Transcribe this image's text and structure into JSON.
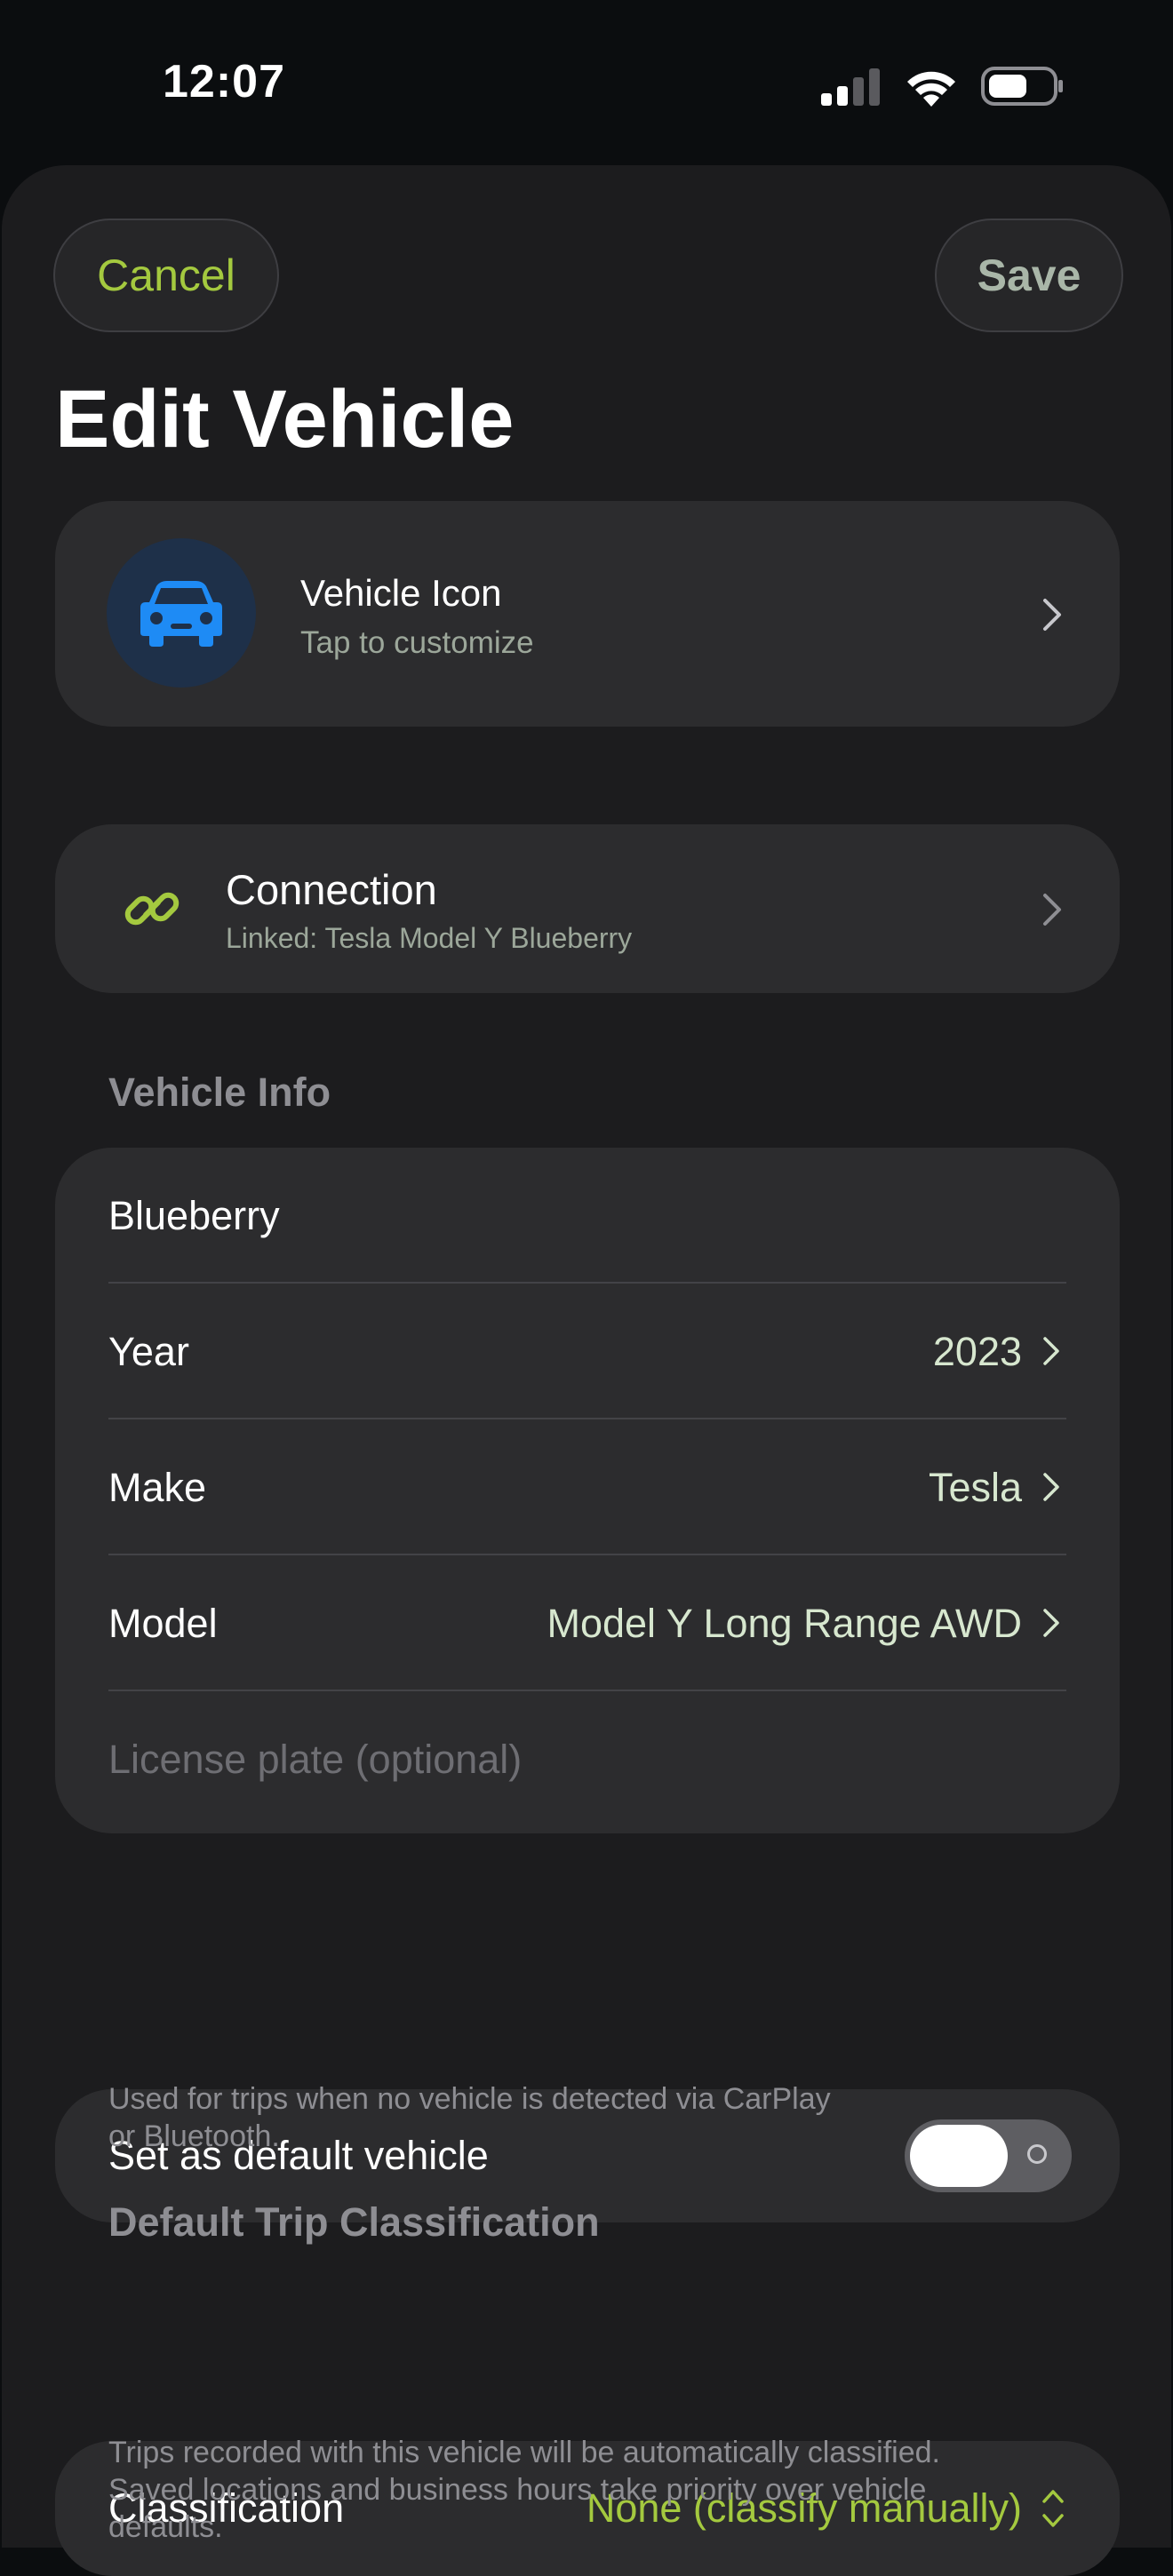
{
  "status_bar": {
    "time": "12:07",
    "icons": [
      "signal-icon",
      "wifi-icon",
      "battery-icon"
    ]
  },
  "nav": {
    "cancel_label": "Cancel",
    "save_label": "Save",
    "title": "Edit Vehicle"
  },
  "vehicle_icon": {
    "icon": "car-icon",
    "title": "Vehicle Icon",
    "subtitle": "Tap to customize"
  },
  "connection": {
    "icon": "link-icon",
    "title": "Connection",
    "subtitle": "Linked: Tesla Model Y Blueberry"
  },
  "vehicle_info": {
    "header": "Vehicle Info",
    "name_value": "Blueberry",
    "rows": [
      {
        "label": "Year",
        "value": "2023"
      },
      {
        "label": "Make",
        "value": "Tesla"
      },
      {
        "label": "Model",
        "value": "Model Y Long Range AWD"
      }
    ],
    "plate_placeholder": "License plate (optional)"
  },
  "default_vehicle": {
    "label": "Set as default vehicle",
    "enabled": false,
    "footnote_line1": "Used for trips when no vehicle is detected via CarPlay",
    "footnote_line2": "or Bluetooth."
  },
  "classification": {
    "header": "Default Trip Classification",
    "label": "Classification",
    "value": "None (classify manually)",
    "footnote_line1": "Trips recorded with this vehicle will be automatically classified.",
    "footnote_line2": "Saved locations and business hours take priority over vehicle",
    "footnote_line3": "defaults."
  },
  "colors": {
    "accent": "#a4c93f",
    "background": "#1c1c1e",
    "card": "#2c2c2e",
    "car_icon": "#1e8bf5"
  }
}
